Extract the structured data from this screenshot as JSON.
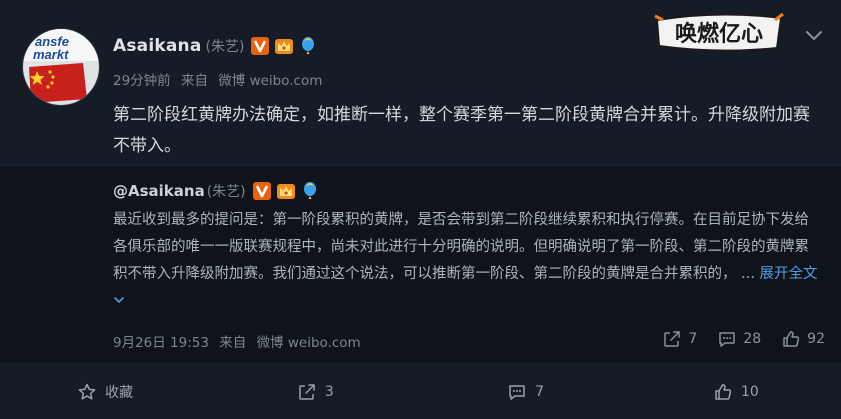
{
  "post": {
    "author": {
      "name": "Asaikana",
      "real_name": "(朱艺)",
      "avatar_text_1": "ansfe",
      "avatar_text_2": "markt"
    },
    "meta": {
      "time": "29分钟前",
      "source_prefix": "来自",
      "source": "微博 weibo.com"
    },
    "content": "第二阶段红黄牌办法确定，如推断一样，整个赛季第一第二阶段黄牌合并累计。升降级附加赛不带入。",
    "brand_logo_text": "唤燃亿心"
  },
  "repost": {
    "author_handle": "@Asaikana",
    "author_real": "(朱艺)",
    "text": "最近收到最多的提问是：第一阶段累积的黄牌，是否会带到第二阶段继续累积和执行停赛。在目前足协下发给各俱乐部的唯一一版联赛规程中，尚未对此进行十分明确的说明。但明确说明了第一阶段、第二阶段的黄牌累积不带入升降级附加赛。我们通过这个说法，可以推断第一阶段、第二阶段的黄牌是合并累积的，",
    "ellipsis": " ... ",
    "expand_label": "展开全文",
    "meta": {
      "date": "9月26日 19:53",
      "source_prefix": "来自",
      "source": "微博 weibo.com"
    },
    "actions": {
      "share_count": "7",
      "comment_count": "28",
      "like_count": "92"
    }
  },
  "toolbar": {
    "favorite_label": "收藏",
    "share_count": "3",
    "comment_count": "7",
    "like_count": "10"
  },
  "colors": {
    "background": "#151c26",
    "repost_background": "#0f141b",
    "link": "#4f9fe6",
    "vip_badge": "#e8620e"
  },
  "icons": [
    "more-chevron-icon",
    "vip-v-icon",
    "crown-icon",
    "balloon-icon",
    "share-icon",
    "comment-icon",
    "like-icon",
    "star-icon"
  ]
}
